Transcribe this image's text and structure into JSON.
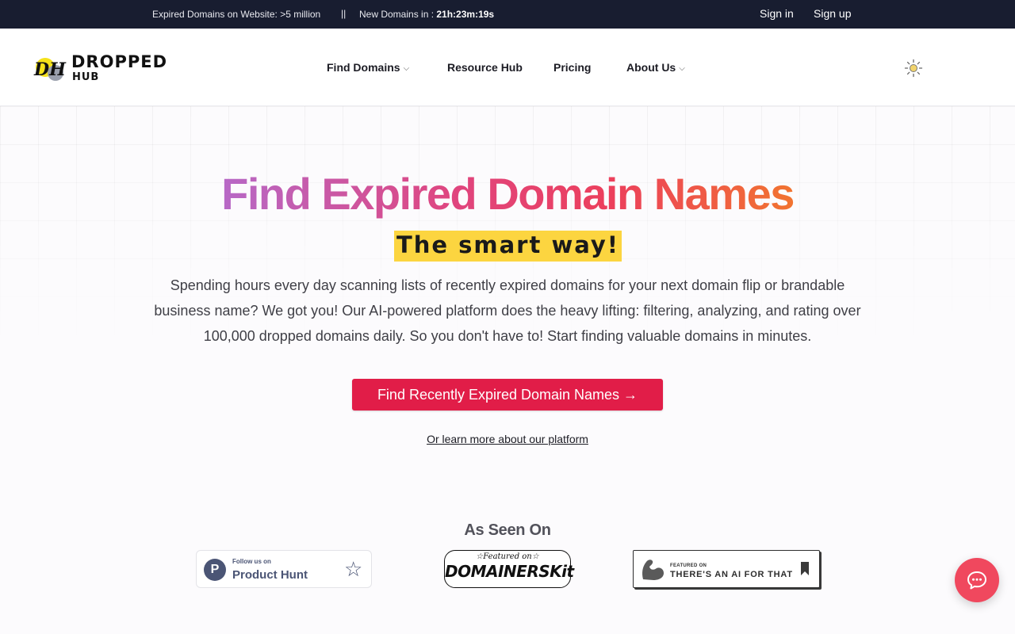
{
  "topbar": {
    "expired_label": "Expired Domains on Website: ",
    "expired_value": ">5 million",
    "separator": "||",
    "new_label": "New Domains in : ",
    "new_countdown": "21h:23m:19s",
    "sign_in": "Sign in",
    "sign_up": "Sign up"
  },
  "logo": {
    "mark_text": "DH",
    "word1": "DROPPED",
    "word2": "HUB"
  },
  "nav": {
    "find_domains": "Find Domains",
    "resource_hub": "Resource Hub",
    "pricing": "Pricing",
    "about_us": "About Us",
    "chevron": "⌵"
  },
  "hero": {
    "title": "Find Expired Domain Names",
    "subtitle": "The smart way!",
    "description": "Spending hours every day scanning lists of recently expired domains for your next domain flip or brandable business name? We got you! Our AI-powered platform does the heavy lifting: filtering, analyzing, and rating over 100,000 dropped domains daily. So you don't have to! Start finding valuable domains in minutes.",
    "cta_label": "Find Recently Expired Domain Names →",
    "learn_more": "Or learn more about our platform"
  },
  "seen_on": {
    "title": "As Seen On",
    "product_hunt": {
      "small": "Follow us on",
      "big": "Product Hunt",
      "letter": "P",
      "star": "☆"
    },
    "domainerskit": {
      "small": "☆Featured on☆",
      "big": "DOMAINERSKit"
    },
    "ai_for_that": {
      "small": "FEATURED ON",
      "big": "THERE'S AN AI FOR THAT"
    }
  },
  "colors": {
    "topbar_bg": "#181d30",
    "cta_bg": "#e11d48",
    "highlight": "#fcd540",
    "chat_bg": "#f0485e"
  },
  "icons": [
    "sun-icon",
    "chevron-down-icon",
    "chat-icon",
    "product-hunt-logo",
    "star-icon",
    "bookmark-icon",
    "arm-icon"
  ]
}
